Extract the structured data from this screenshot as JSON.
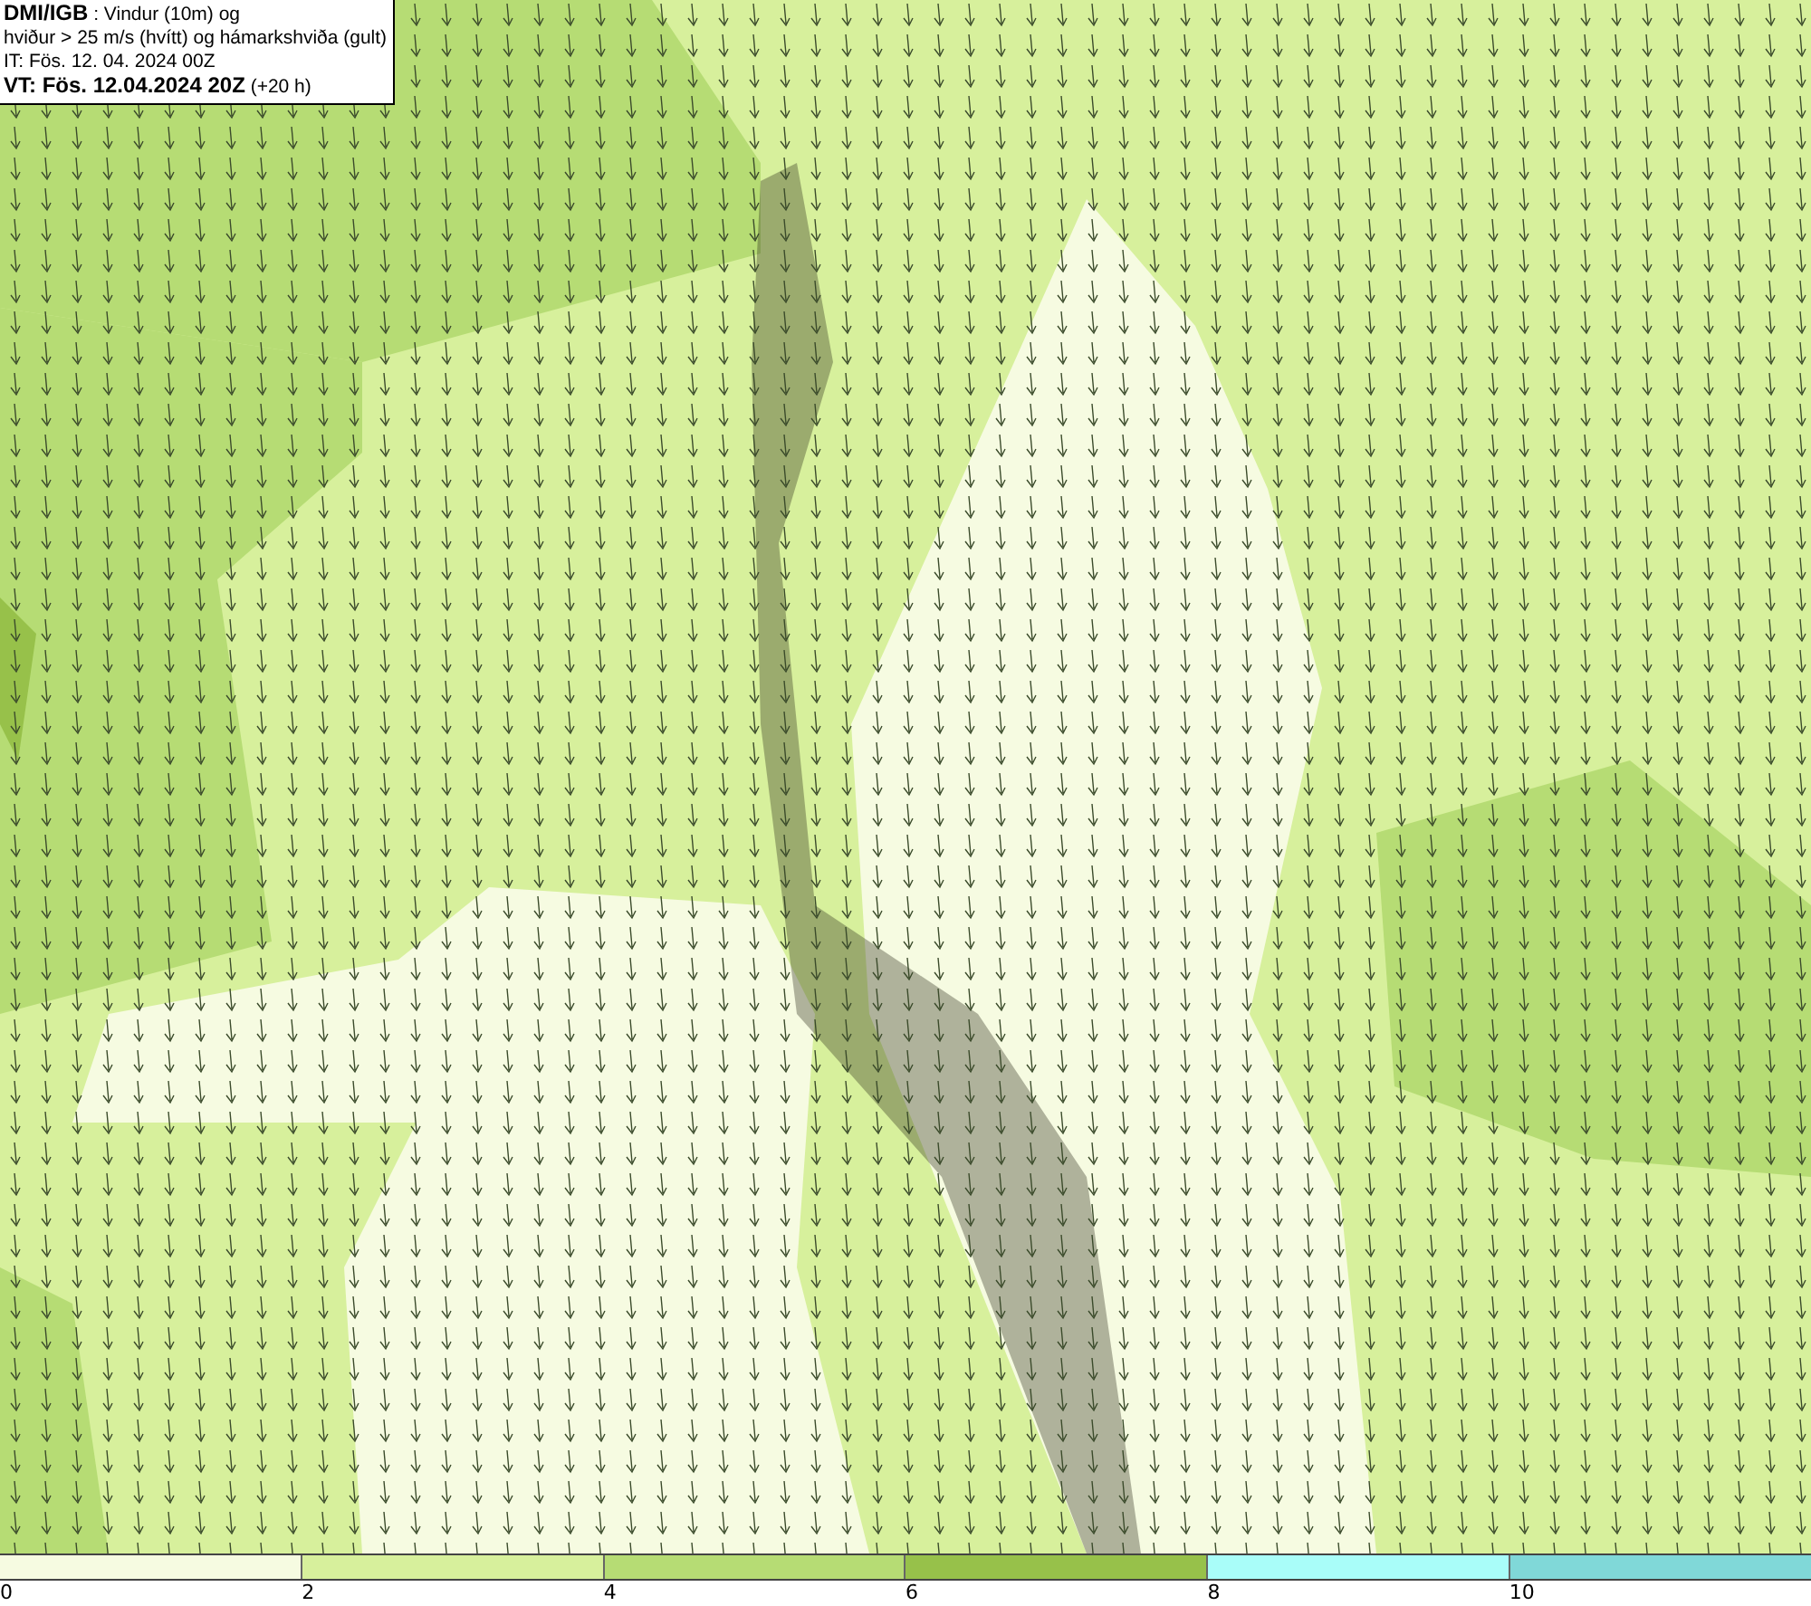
{
  "info_box": {
    "lines": [
      "**DMI/IGB** : Vindur (10m) og",
      "hviður > 25 m/s (hvítt) og hámarkshviða (gult)",
      "IT: Fös. 12. 04. 2024 00Z",
      "**VT: Fös. 12.04.2024 20Z** (+20 h)"
    ]
  },
  "legend": {
    "segments": [
      {
        "color": "#f6fbe1"
      },
      {
        "color": "#d7f09c"
      },
      {
        "color": "#b6dc74"
      },
      {
        "color": "#97c14a"
      },
      {
        "color": "#a9fdf9"
      },
      {
        "color": "#80d8d8"
      }
    ],
    "ticks": [
      "0",
      "2",
      "4",
      "6",
      "8",
      "10"
    ]
  }
}
